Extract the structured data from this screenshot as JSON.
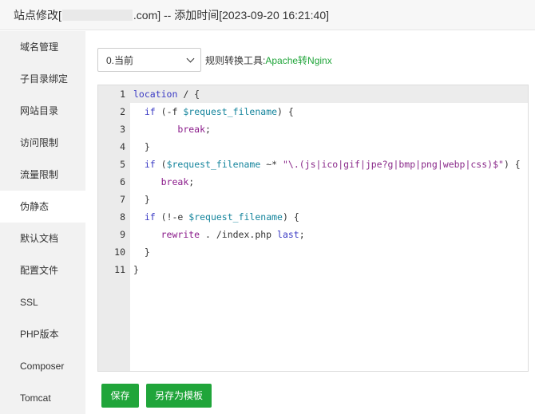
{
  "title": {
    "prefix": "站点修改[",
    "suffix": ".com] -- 添加时间[2023-09-20 16:21:40]"
  },
  "sidebar": {
    "items": [
      {
        "label": "域名管理"
      },
      {
        "label": "子目录绑定"
      },
      {
        "label": "网站目录"
      },
      {
        "label": "访问限制"
      },
      {
        "label": "流量限制"
      },
      {
        "label": "伪静态",
        "active": true
      },
      {
        "label": "默认文档"
      },
      {
        "label": "配置文件"
      },
      {
        "label": "SSL"
      },
      {
        "label": "PHP版本"
      },
      {
        "label": "Composer"
      },
      {
        "label": "Tomcat"
      }
    ]
  },
  "toolbar": {
    "select_value": "0.当前",
    "tool_label": "规则转换工具:",
    "tool_link": "Apache转Nginx"
  },
  "editor": {
    "line_numbers": [
      "1",
      "2",
      "3",
      "4",
      "5",
      "6",
      "7",
      "8",
      "9",
      "10",
      "11"
    ],
    "active_line": 1,
    "lines": [
      "location / {",
      "  if (-f $request_filename) {",
      "        break;",
      "  }",
      "  if ($request_filename ~* \"\\.(js|ico|gif|jpe?g|bmp|png|webp|css)$\") {",
      "     break;",
      "  }",
      "  if (!-e $request_filename) {",
      "     rewrite . /index.php last;",
      "  }",
      "}"
    ]
  },
  "buttons": {
    "save": "保存",
    "save_template": "另存为模板"
  },
  "colors": {
    "accent": "#20a53a",
    "sidebar_bg": "#f2f2f2",
    "gutter_bg": "#ebebeb"
  }
}
